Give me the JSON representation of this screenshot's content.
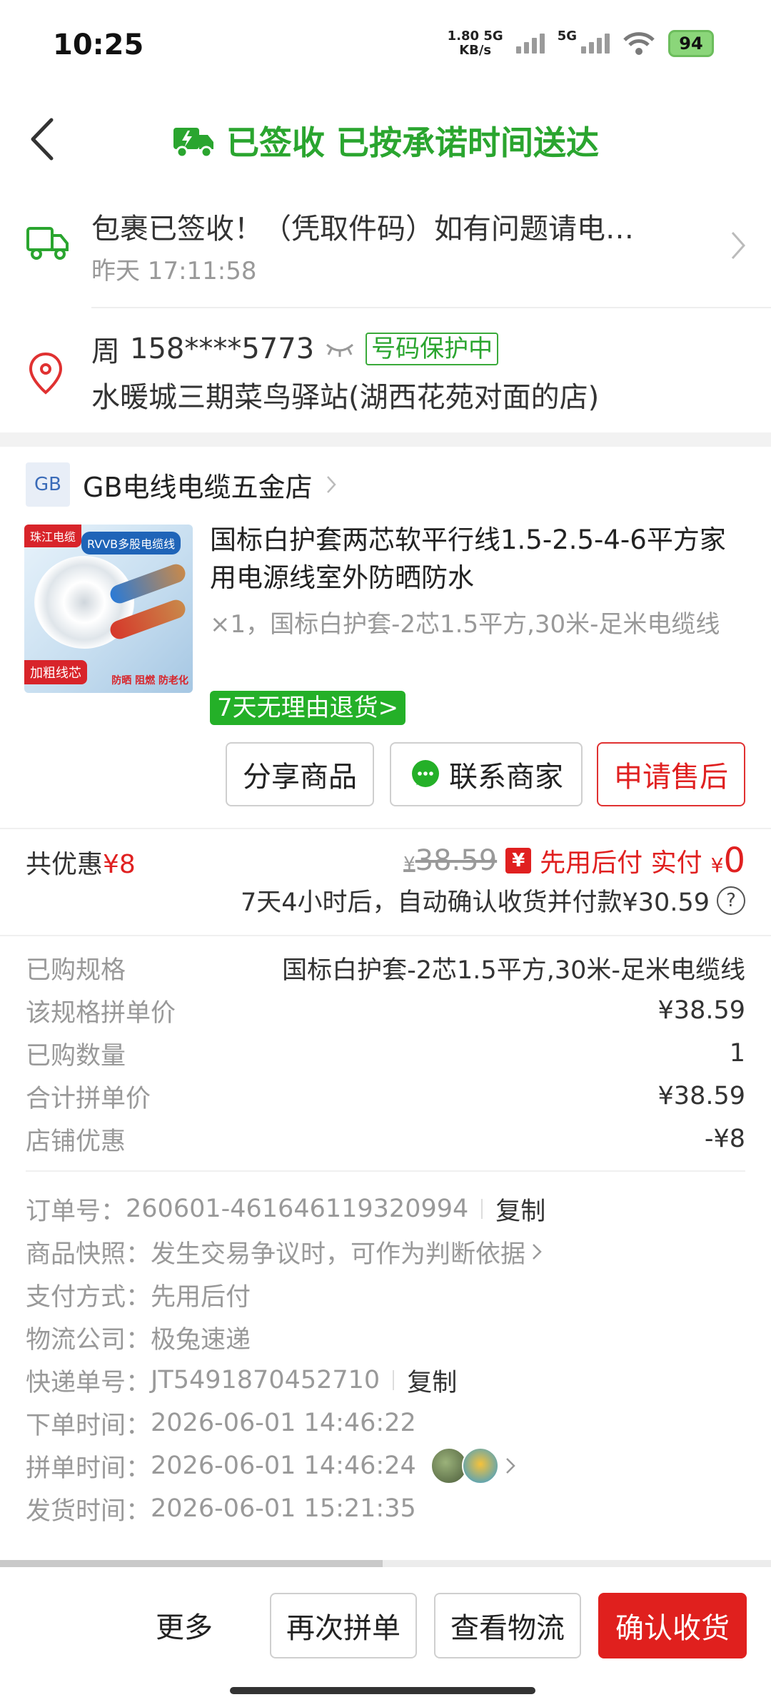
{
  "status_bar": {
    "time": "10:25",
    "speed_value": "1.80",
    "speed_unit": "KB/s",
    "net1": "5G",
    "net2": "5G",
    "battery": "94"
  },
  "header": {
    "title": "已签收 已按承诺时间送达",
    "accent_color": "#2aa52f"
  },
  "tracking": {
    "message": "包裹已签收！（凭取件码）如有问题请电…",
    "time": "昨天 17:11:58"
  },
  "address": {
    "name": "周",
    "phone": "158****5773",
    "badge": "号码保护中",
    "location": "水暖城三期菜鸟驿站(湖西花苑对面的店)"
  },
  "shop": {
    "logo": "GB",
    "name": "GB电线电缆五金店"
  },
  "product": {
    "image_texts": {
      "brand": "珠江电缆",
      "type": "RVVB多股电缆线",
      "tag": "加粗线芯",
      "features": "防晒 阻燃 防老化"
    },
    "title": "国标白护套两芯软平行线1.5-2.5-4-6平方家用电源线室外防晒防水",
    "spec": "×1，国标白护套-2芯1.5平方,30米-足米电缆线",
    "return_policy": "7天无理由退货",
    "return_chevron": ">"
  },
  "actions": {
    "share": "分享商品",
    "contact": "联系商家",
    "after_sale": "申请售后"
  },
  "summary": {
    "discount_label": "共优惠",
    "discount_value": "¥8",
    "original_currency": "¥",
    "original_price": "38.59",
    "pay_later_icon": "¥",
    "pay_later_text": "先用后付 实付",
    "paid_currency": "¥",
    "paid_value": "0",
    "auto_confirm": "7天4小时后，自动确认收货并付款¥30.59",
    "help": "?"
  },
  "details": [
    {
      "key": "已购规格",
      "value": "国标白护套-2芯1.5平方,30米-足米电缆线"
    },
    {
      "key": "该规格拼单价",
      "value": "¥38.59"
    },
    {
      "key": "已购数量",
      "value": "1"
    },
    {
      "key": "合计拼单价",
      "value": "¥38.59"
    },
    {
      "key": "店铺优惠",
      "value": "-¥8"
    }
  ],
  "order_info": {
    "order_no_label": "订单号：",
    "order_no": "260601-461646119320994",
    "copy": "复制",
    "snapshot_label": "商品快照：",
    "snapshot_text": "发生交易争议时，可作为判断依据",
    "payment_label": "支付方式：",
    "payment": "先用后付",
    "carrier_label": "物流公司：",
    "carrier": "极兔速递",
    "tracking_no_label": "快递单号：",
    "tracking_no": "JT5491870452710",
    "order_time_label": "下单时间：",
    "order_time": "2026-06-01 14:46:22",
    "group_time_label": "拼单时间：",
    "group_time": "2026-06-01 14:46:24",
    "ship_time_label": "发货时间：",
    "ship_time": "2026-06-01 15:21:35"
  },
  "bottom_bar": {
    "more": "更多",
    "buy_again": "再次拼单",
    "view_logistics": "查看物流",
    "confirm_receipt": "确认收货",
    "confirm_color": "#e0201e"
  }
}
